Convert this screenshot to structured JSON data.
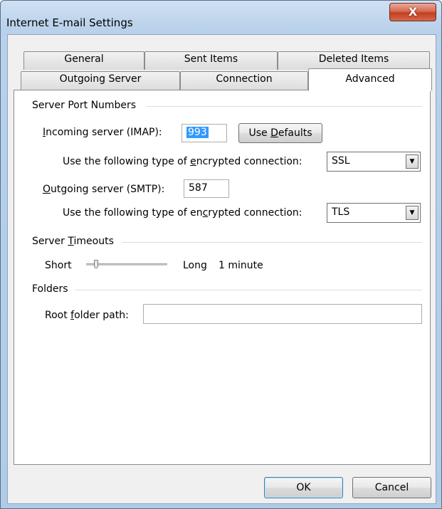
{
  "window": {
    "title": "Internet E-mail Settings",
    "close_glyph": "X"
  },
  "tabs_row1": [
    {
      "label": "General"
    },
    {
      "label": "Sent Items"
    },
    {
      "label": "Deleted Items"
    }
  ],
  "tabs_row2": [
    {
      "label": "Outgoing Server"
    },
    {
      "label": "Connection"
    },
    {
      "label": "Advanced",
      "active": true
    }
  ],
  "server_ports": {
    "group_label": "Server Port Numbers",
    "incoming_label_pre": "",
    "incoming_label_u": "I",
    "incoming_label_post": "ncoming server (IMAP):",
    "incoming_value": "993",
    "use_defaults_pre": "Use ",
    "use_defaults_u": "D",
    "use_defaults_post": "efaults",
    "enc1_pre": "Use the following type of ",
    "enc1_u": "e",
    "enc1_post": "ncrypted connection:",
    "enc1_value": "SSL",
    "outgoing_label_u": "O",
    "outgoing_label_post": "utgoing server (SMTP):",
    "outgoing_value": "587",
    "enc2_pre": "Use the following type of en",
    "enc2_u": "c",
    "enc2_post": "rypted connection:",
    "enc2_value": "TLS"
  },
  "timeouts": {
    "group_label_pre": "Server ",
    "group_label_u": "T",
    "group_label_post": "imeouts",
    "short_label": "Short",
    "long_label": "Long",
    "value_label": "1 minute",
    "level": 0.1
  },
  "folders": {
    "group_label": "Folders",
    "root_label_pre": "Root ",
    "root_label_u": "f",
    "root_label_post": "older path:",
    "root_value": ""
  },
  "footer": {
    "ok_label": "OK",
    "cancel_label": "Cancel"
  }
}
